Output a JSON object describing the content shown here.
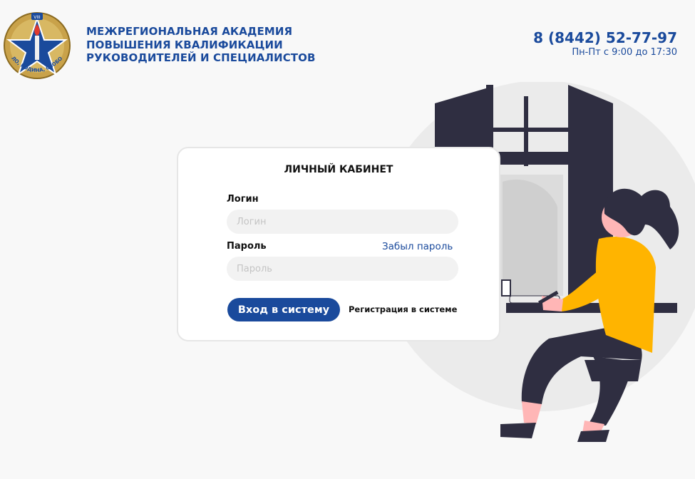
{
  "header": {
    "org_name_lines": [
      "МЕЖРЕГИОНАЛЬНАЯ АКАДЕМИЯ",
      "ПОВЫШЕНИЯ КВАЛИФИКАЦИИ",
      "РУКОВОДИТЕЛЕЙ И СПЕЦИАЛИСТОВ"
    ],
    "phone": "8 (8442) 52-77-97",
    "hours": "Пн-Пт с 9:00 до 17:30"
  },
  "logo": {
    "badge_text": "VIII",
    "motto": "ДЕЛО, РОДИНА, СВОБОДА"
  },
  "login_card": {
    "title": "ЛИЧНЫЙ КАБИНЕТ",
    "login_label": "Логин",
    "login_placeholder": "Логин",
    "login_value": "",
    "password_label": "Пароль",
    "password_placeholder": "Пароль",
    "password_value": "",
    "forgot_password": "Забыл пароль",
    "submit_label": "Вход в систему",
    "register_label": "Регистрация в системе"
  },
  "colors": {
    "brand_blue": "#1a4a9c",
    "illustration_dark": "#2f2e41",
    "illustration_accent": "#ffb400",
    "illustration_skin": "#ffb6b6"
  },
  "icons": {
    "logo": "academy-emblem-icon",
    "illustration": "woman-at-window-illustration"
  }
}
